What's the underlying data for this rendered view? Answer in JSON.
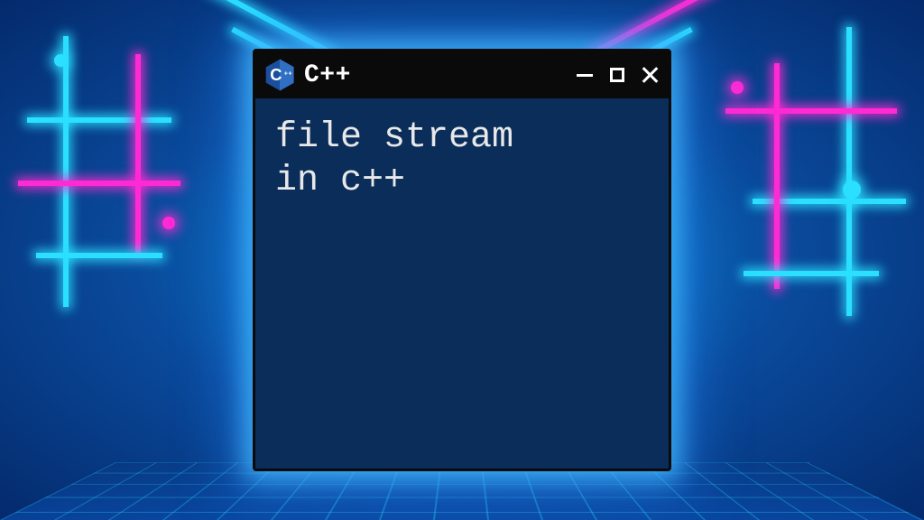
{
  "window": {
    "title": "C++",
    "content_text": "file stream\nin c++"
  },
  "logo": {
    "name": "cpp-logo",
    "letter": "C",
    "plus": "+"
  },
  "colors": {
    "window_bg": "#0a2d5a",
    "titlebar_bg": "#0a0a0a",
    "text": "#e8e8e8",
    "glow_blue": "#2adfff",
    "glow_pink": "#ff2ad4"
  }
}
